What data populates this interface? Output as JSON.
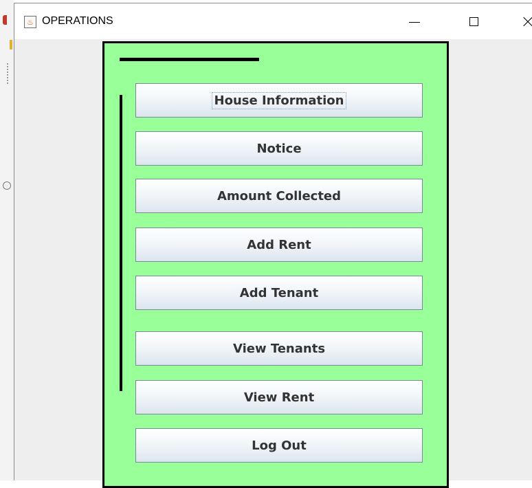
{
  "window": {
    "title": "OPERATIONS",
    "app_icon": "java-coffee-icon"
  },
  "controls": {
    "minimize": "minimize-icon",
    "maximize": "maximize-icon",
    "close": "close-icon"
  },
  "colors": {
    "panel_background": "#99ff99",
    "panel_border": "#000000",
    "window_background": "#eeeeee"
  },
  "menu": {
    "buttons": [
      {
        "label": "House Information",
        "focused": true
      },
      {
        "label": "Notice"
      },
      {
        "label": "Amount Collected"
      },
      {
        "label": "Add Rent"
      },
      {
        "label": "Add Tenant"
      },
      {
        "label": "View Tenants"
      },
      {
        "label": "View Rent"
      },
      {
        "label": "Log Out"
      }
    ]
  }
}
